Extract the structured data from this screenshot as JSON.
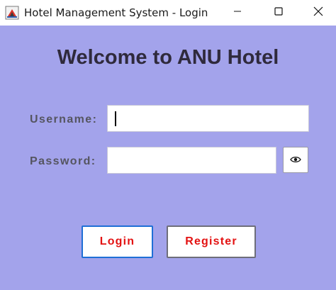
{
  "window": {
    "title": "Hotel Management System - Login",
    "app_icon": "java-app-icon",
    "controls": {
      "minimize_icon": "minimize-icon",
      "maximize_icon": "maximize-icon",
      "close_icon": "close-icon"
    }
  },
  "login_form": {
    "heading": "Welcome to ANU Hotel",
    "username_label": "Username:",
    "username_value": "",
    "password_label": "Password:",
    "password_value": "",
    "show_password_icon": "eye-icon",
    "login_label": "Login",
    "register_label": "Register"
  },
  "colors": {
    "background": "#a3a3eb",
    "heading": "#2f2a3c",
    "label": "#555560",
    "button_text": "#e31212",
    "login_border": "#1f6fd6"
  }
}
